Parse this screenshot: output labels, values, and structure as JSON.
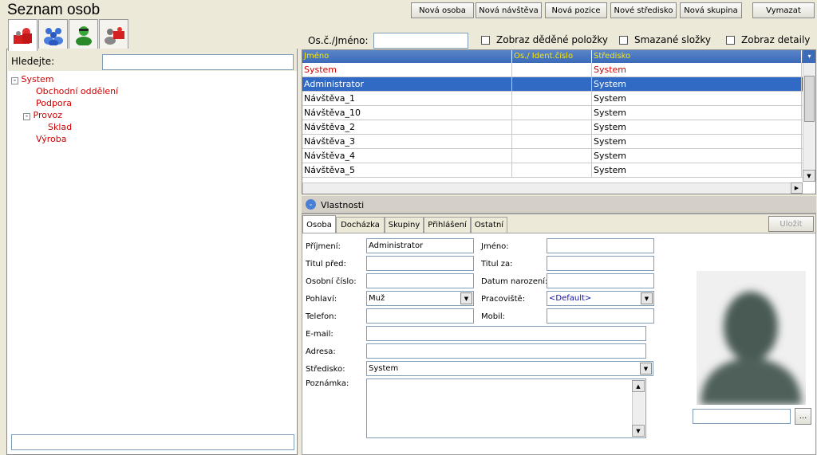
{
  "app": {
    "title": "Seznam osob"
  },
  "toolbar": {
    "new_person": "Nová osoba",
    "new_visit": "Nová návštěva",
    "new_position": "Nová pozice",
    "new_center": "Nové středisko",
    "new_group": "Nová skupina",
    "delete": "Vymazat"
  },
  "filter": {
    "id_name_label": "Os.č./Jméno:",
    "id_name_value": "",
    "show_inherited": "Zobraz děděné položky",
    "deleted_folders": "Smazané složky",
    "show_details": "Zobraz detaily"
  },
  "left": {
    "search_label": "Hledejte:",
    "search_value": "",
    "bottom_value": ""
  },
  "tree": {
    "root": "System",
    "expand_symbol": "-",
    "items": [
      {
        "label": "Obchodní oddělení"
      },
      {
        "label": "Podpora"
      },
      {
        "label": "Provoz"
      },
      {
        "label": "Sklad"
      },
      {
        "label": "Výroba"
      }
    ]
  },
  "grid": {
    "columns": [
      "Jméno",
      "Os./ Ident.číslo",
      "Středisko"
    ],
    "rows": [
      {
        "name": "System",
        "id": "",
        "center": "System"
      },
      {
        "name": "Administrator",
        "id": "",
        "center": "System"
      },
      {
        "name": "Návštěva_1",
        "id": "",
        "center": "System"
      },
      {
        "name": "Návštěva_10",
        "id": "",
        "center": "System"
      },
      {
        "name": "Návštěva_2",
        "id": "",
        "center": "System"
      },
      {
        "name": "Návštěva_3",
        "id": "",
        "center": "System"
      },
      {
        "name": "Návštěva_4",
        "id": "",
        "center": "System"
      },
      {
        "name": "Návštěva_5",
        "id": "",
        "center": "System"
      }
    ]
  },
  "properties": {
    "title": "Vlastnosti",
    "save": "Uložit",
    "tabs": [
      "Osoba",
      "Docházka",
      "Skupiny",
      "Přihlášení",
      "Ostatní"
    ],
    "labels": {
      "surname": "Příjmení:",
      "title_before": "Titul před:",
      "personal_no": "Osobní číslo:",
      "gender": "Pohlaví:",
      "phone": "Telefon:",
      "email": "E-mail:",
      "address": "Adresa:",
      "center": "Středisko:",
      "note": "Poznámka:",
      "first_name": "Jméno:",
      "title_after": "Titul za:",
      "birth_date": "Datum narození:",
      "workplace": "Pracoviště:",
      "mobile": "Mobil:"
    },
    "values": {
      "surname": "Administrator",
      "title_before": "",
      "personal_no": "",
      "gender": "Muž",
      "phone": "",
      "email": "",
      "address": "",
      "center": "System",
      "note": "",
      "first_name": "",
      "title_after": "",
      "birth_date": "",
      "workplace": "<Default>",
      "mobile": "",
      "photo_path": ""
    },
    "browse": "..."
  },
  "colors": {
    "accent": "#316ac5",
    "tree_text": "#d00000",
    "header_text": "#ffe800"
  },
  "icons": [
    "users-red-icon",
    "users-blue-icon",
    "user-green-icon",
    "users-gray-icon"
  ]
}
